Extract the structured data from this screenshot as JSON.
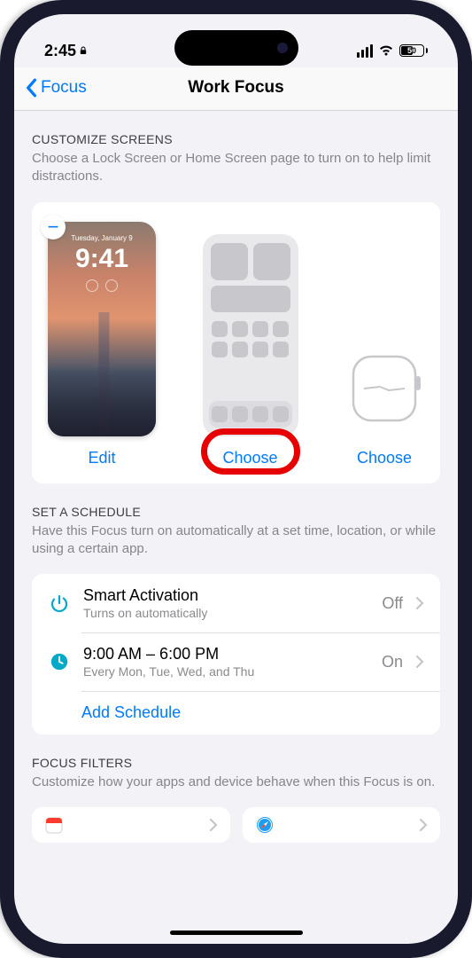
{
  "status_bar": {
    "time": "2:45",
    "battery_pct": "50"
  },
  "nav": {
    "back_label": "Focus",
    "title": "Work Focus"
  },
  "customize": {
    "header": "Customize Screens",
    "desc": "Choose a Lock Screen or Home Screen page to turn on to help limit distractions.",
    "lock_screen": {
      "date": "Tuesday, January 9",
      "time": "9:41",
      "action": "Edit"
    },
    "home_screen": {
      "action": "Choose"
    },
    "watch": {
      "action": "Choose"
    }
  },
  "schedule": {
    "header": "Set a Schedule",
    "desc": "Have this Focus turn on automatically at a set time, location, or while using a certain app.",
    "smart": {
      "title": "Smart Activation",
      "sub": "Turns on automatically",
      "value": "Off"
    },
    "time": {
      "title": "9:00 AM – 6:00 PM",
      "sub": "Every Mon, Tue, Wed, and Thu",
      "value": "On"
    },
    "add": "Add Schedule"
  },
  "filters": {
    "header": "Focus Filters",
    "desc": "Customize how your apps and device behave when this Focus is on."
  }
}
